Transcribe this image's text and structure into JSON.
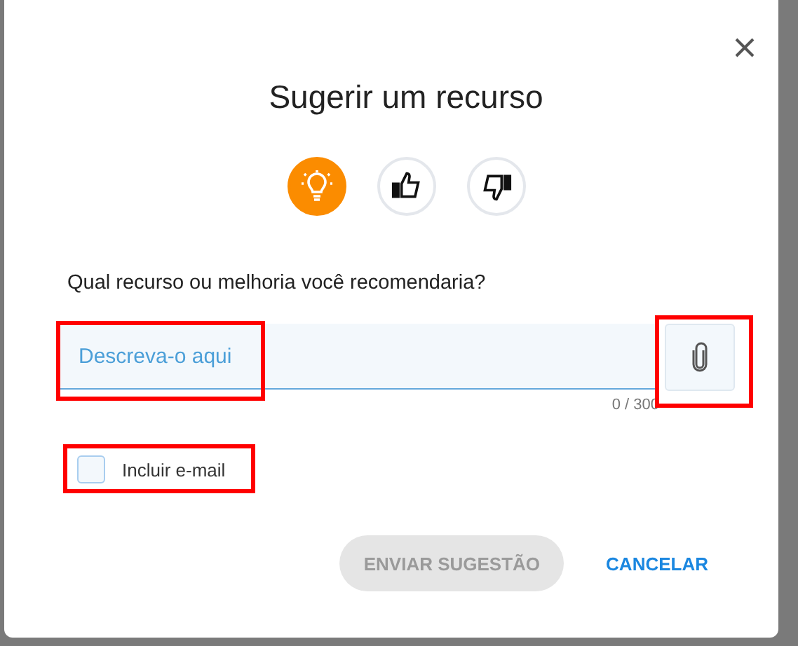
{
  "dialog": {
    "title": "Sugerir um recurso"
  },
  "types": [
    {
      "kind": "idea",
      "selected": true
    },
    {
      "kind": "like",
      "selected": false
    },
    {
      "kind": "dislike",
      "selected": false
    }
  ],
  "question": "Qual recurso ou melhoria você recomendaria?",
  "field": {
    "placeholder": "Descreva-o aqui",
    "counter": "0 / 300",
    "highlighted": true
  },
  "attach": {
    "highlighted": true
  },
  "include_email": {
    "label": "Incluir e-mail",
    "checked": false,
    "highlighted": true
  },
  "buttons": [
    {
      "label": "ENVIAR SUGESTÃO",
      "kind": "submit",
      "disabled": true
    },
    {
      "label": "CANCELAR",
      "kind": "cancel",
      "disabled": false
    }
  ]
}
